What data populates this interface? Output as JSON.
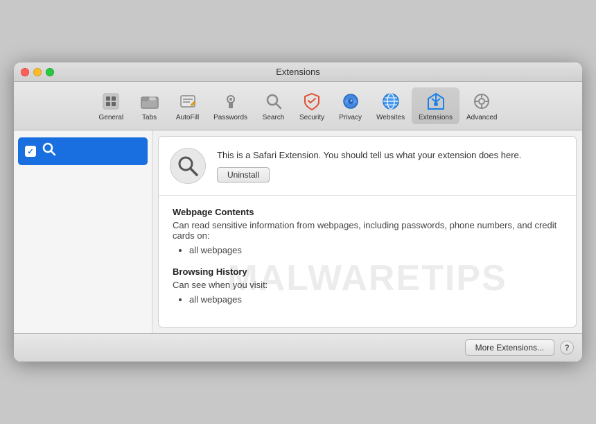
{
  "window": {
    "title": "Extensions"
  },
  "toolbar": {
    "items": [
      {
        "id": "general",
        "label": "General",
        "icon": "general"
      },
      {
        "id": "tabs",
        "label": "Tabs",
        "icon": "tabs"
      },
      {
        "id": "autofill",
        "label": "AutoFill",
        "icon": "autofill"
      },
      {
        "id": "passwords",
        "label": "Passwords",
        "icon": "passwords"
      },
      {
        "id": "search",
        "label": "Search",
        "icon": "search"
      },
      {
        "id": "security",
        "label": "Security",
        "icon": "security"
      },
      {
        "id": "privacy",
        "label": "Privacy",
        "icon": "privacy"
      },
      {
        "id": "websites",
        "label": "Websites",
        "icon": "websites"
      },
      {
        "id": "extensions",
        "label": "Extensions",
        "icon": "extensions",
        "active": true
      },
      {
        "id": "advanced",
        "label": "Advanced",
        "icon": "advanced"
      }
    ]
  },
  "sidebar": {
    "items": [
      {
        "id": "search-ext",
        "label": "",
        "checked": true,
        "selected": true
      }
    ]
  },
  "extension_detail": {
    "header_text": "This is a Safari Extension. You should tell us what your extension does here.",
    "uninstall_label": "Uninstall",
    "sections": [
      {
        "title": "Webpage Contents",
        "description": "Can read sensitive information from webpages, including passwords, phone numbers, and credit cards on:",
        "items": [
          "all webpages"
        ]
      },
      {
        "title": "Browsing History",
        "description": "Can see when you visit:",
        "items": [
          "all webpages"
        ]
      }
    ]
  },
  "bottom_bar": {
    "more_extensions_label": "More Extensions...",
    "help_label": "?"
  },
  "watermark": {
    "text": "MALWARETIPS"
  }
}
